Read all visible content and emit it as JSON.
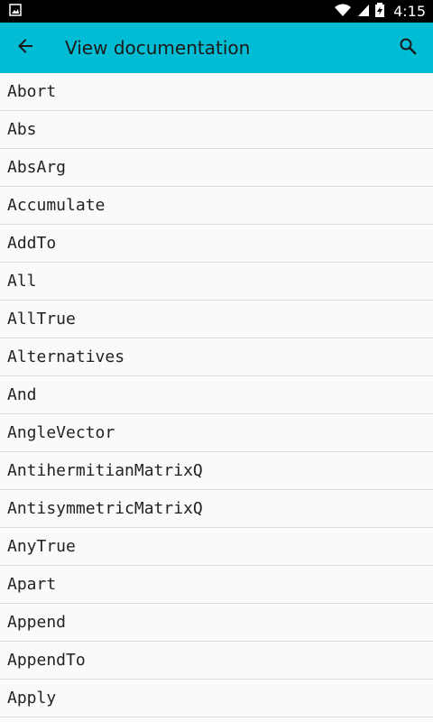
{
  "status_bar": {
    "time": "4:15",
    "icons": [
      "image-icon",
      "wifi-icon",
      "signal-icon",
      "battery-charging-icon"
    ]
  },
  "app_bar": {
    "title": "View documentation",
    "back_icon": "arrow-back-icon",
    "search_icon": "search-icon"
  },
  "list": {
    "items": [
      "Abort",
      "Abs",
      "AbsArg",
      "Accumulate",
      "AddTo",
      "All",
      "AllTrue",
      "Alternatives",
      "And",
      "AngleVector",
      "AntihermitianMatrixQ",
      "AntisymmetricMatrixQ",
      "AnyTrue",
      "Apart",
      "Append",
      "AppendTo",
      "Apply"
    ]
  },
  "colors": {
    "app_bar": "#00bcd4",
    "status_bar": "#000000",
    "background": "#fafafa",
    "divider": "#dcdcdc"
  }
}
